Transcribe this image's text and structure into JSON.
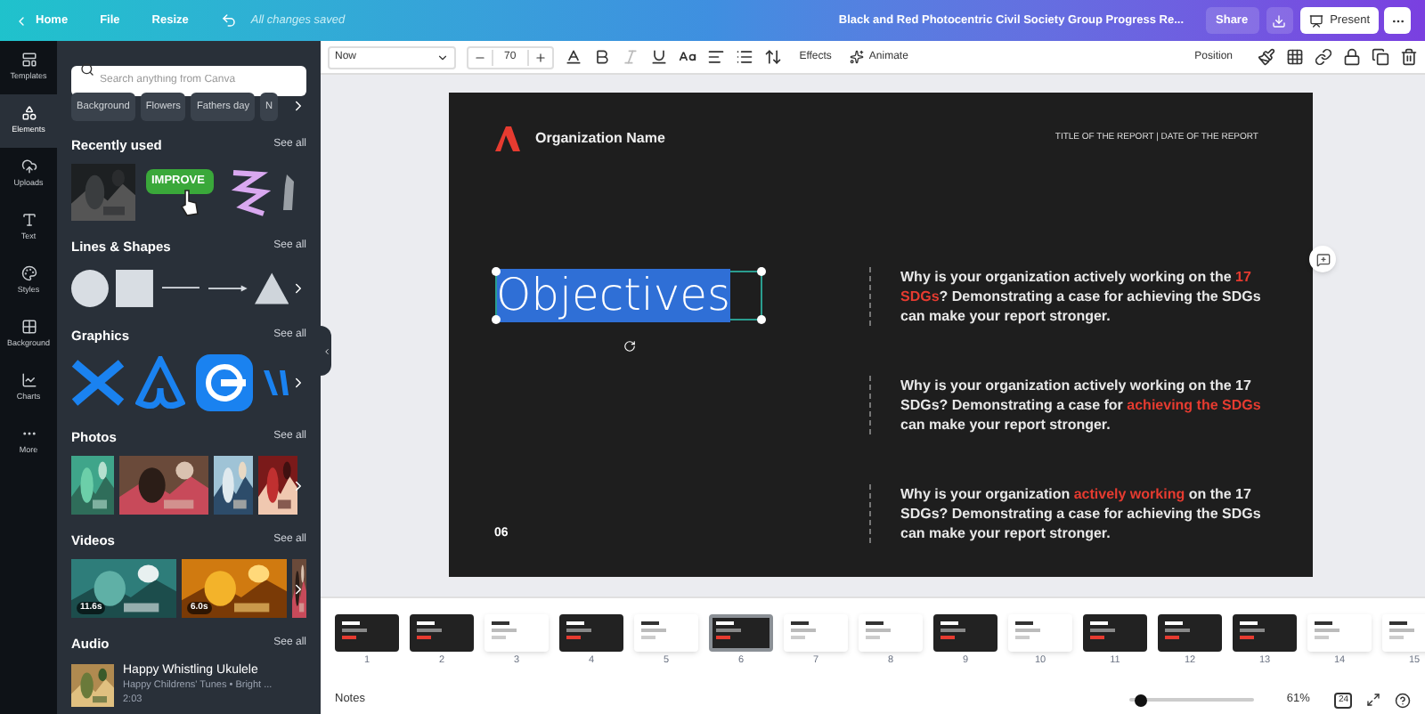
{
  "topbar": {
    "nav": [
      "Home",
      "File",
      "Resize"
    ],
    "status": "All changes saved",
    "doc_title": "Black and Red Photocentric Civil Society Group Progress Re...",
    "share": "Share",
    "present": "Present"
  },
  "rail": [
    {
      "kind": "templates",
      "label": "Templates",
      "selected": false
    },
    {
      "kind": "elements",
      "label": "Elements",
      "selected": true
    },
    {
      "kind": "uploads",
      "label": "Uploads",
      "selected": false
    },
    {
      "kind": "text",
      "label": "Text",
      "selected": false
    },
    {
      "kind": "styles",
      "label": "Styles",
      "selected": false
    },
    {
      "kind": "background",
      "label": "Background",
      "selected": false
    },
    {
      "kind": "charts",
      "label": "Charts",
      "selected": false
    },
    {
      "kind": "more",
      "label": "More",
      "selected": false
    }
  ],
  "panel": {
    "search": {
      "placeholder": "Search anything from Canva"
    },
    "chips": [
      "Background",
      "Flowers",
      "Fathers day",
      "N"
    ],
    "sections": [
      {
        "kind": "recent",
        "title": "Recently used",
        "see_all": "See all",
        "sticker": "IMPROVE"
      },
      {
        "kind": "shapes",
        "title": "Lines & Shapes",
        "see_all": "See all"
      },
      {
        "kind": "graphics",
        "title": "Graphics",
        "see_all": "See all"
      },
      {
        "kind": "photos",
        "title": "Photos",
        "see_all": "See all"
      },
      {
        "kind": "videos",
        "title": "Videos",
        "see_all": "See all",
        "durations": [
          "11.6s",
          "6.0s"
        ]
      },
      {
        "kind": "audio",
        "title": "Audio",
        "see_all": "See all",
        "track": {
          "title": "Happy Whistling Ukulele",
          "subtitle": "Happy Childrens' Tunes • Bright ...",
          "duration": "2:03"
        }
      }
    ]
  },
  "toolbar": {
    "font": "Now",
    "size": "70",
    "effects": "Effects",
    "animate": "Animate",
    "position": "Position"
  },
  "slide": {
    "org": "Organization Name",
    "header": "TITLE OF THE REPORT | DATE OF THE REPORT",
    "heading": "Objectives",
    "page": "06",
    "paragraphs": [
      [
        {
          "text": "Why is your organization actively working on the ",
          "highlight": false
        },
        {
          "text": "17 SDGs",
          "highlight": true
        },
        {
          "text": "? Demonstrating a case for achieving the SDGs can make your report stronger.",
          "highlight": false
        }
      ],
      [
        {
          "text": "Why is your organization actively working on the 17 SDGs? Demonstrating a case for ",
          "highlight": false
        },
        {
          "text": "achieving the SDGs",
          "highlight": true
        },
        {
          "text": " can make your report stronger.",
          "highlight": false
        }
      ],
      [
        {
          "text": "Why is your organization ",
          "highlight": false
        },
        {
          "text": "actively working",
          "highlight": true
        },
        {
          "text": " on the 17 SDGs? Demonstrating a case for achieving the SDGs can make your report stronger.",
          "highlight": false
        }
      ]
    ]
  },
  "thumbnails": [
    {
      "number": "1",
      "kind": "dark",
      "selected": false
    },
    {
      "number": "2",
      "kind": "dark",
      "selected": false
    },
    {
      "number": "3",
      "kind": "light",
      "selected": false
    },
    {
      "number": "4",
      "kind": "dark",
      "selected": false
    },
    {
      "number": "5",
      "kind": "light",
      "selected": false
    },
    {
      "number": "6",
      "kind": "dark",
      "selected": true
    },
    {
      "number": "7",
      "kind": "light",
      "selected": false
    },
    {
      "number": "8",
      "kind": "light",
      "selected": false
    },
    {
      "number": "9",
      "kind": "dark",
      "selected": false
    },
    {
      "number": "10",
      "kind": "light",
      "selected": false
    },
    {
      "number": "11",
      "kind": "dark",
      "selected": false
    },
    {
      "number": "12",
      "kind": "dark",
      "selected": false
    },
    {
      "number": "13",
      "kind": "dark",
      "selected": false
    },
    {
      "number": "14",
      "kind": "light",
      "selected": false
    },
    {
      "number": "15",
      "kind": "light",
      "selected": false
    }
  ],
  "bottombar": {
    "notes": "Notes",
    "zoom": {
      "level": 0.08
    },
    "zoom_reading": "61%",
    "pages": "24"
  }
}
